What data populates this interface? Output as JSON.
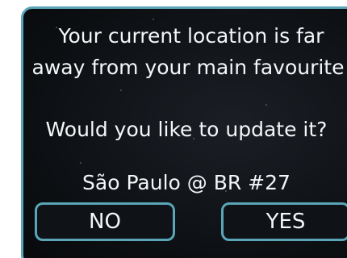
{
  "dialog": {
    "message_line1": "Your current location is far",
    "message_line2": "away from your main favourite",
    "question": "Would you like to update it?",
    "location": "São Paulo @ BR #27",
    "no_label": "NO",
    "yes_label": "YES"
  },
  "colors": {
    "border": "#5aa6b8",
    "background": "#0f1216",
    "text": "#f4f6f8"
  }
}
